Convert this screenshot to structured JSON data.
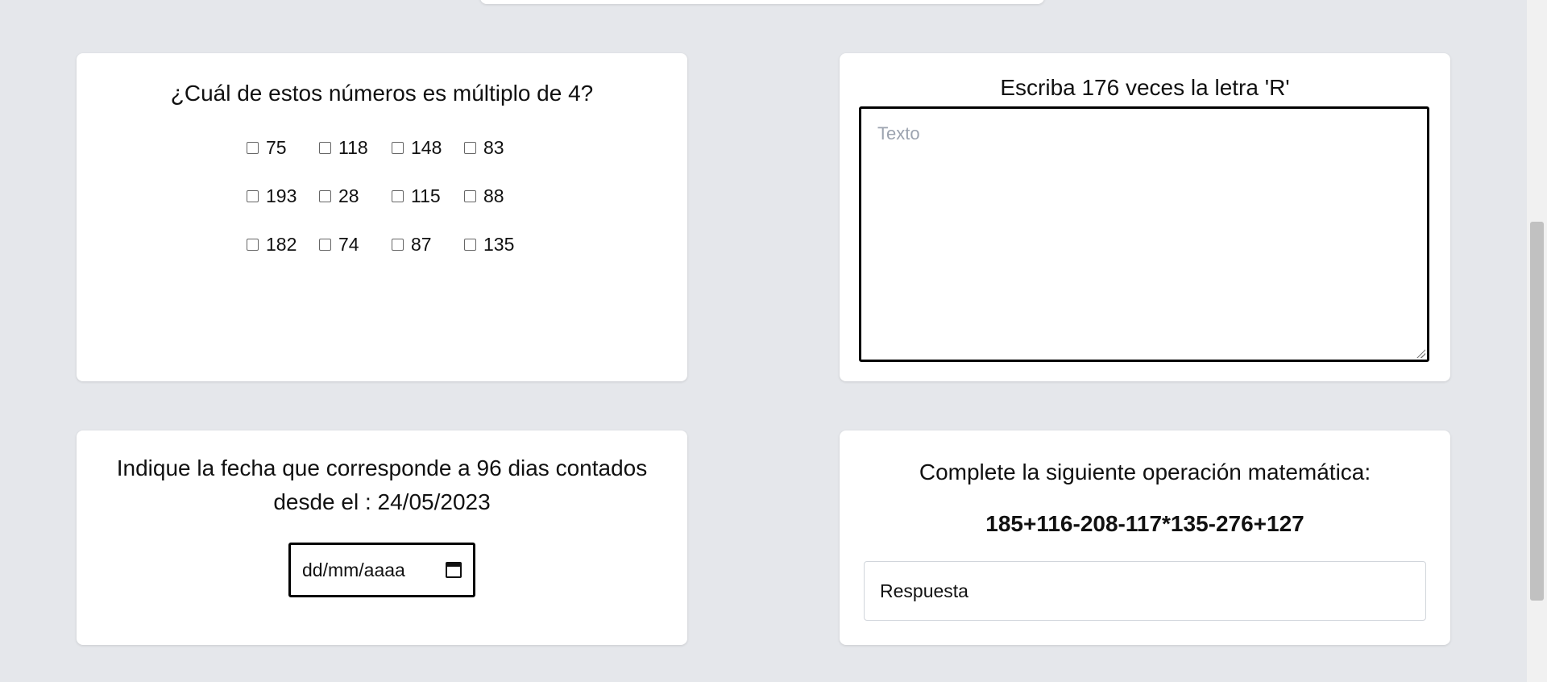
{
  "multiple_choice": {
    "question": "¿Cuál de estos números es múltiplo de 4?",
    "options": [
      "75",
      "118",
      "148",
      "83",
      "193",
      "28",
      "115",
      "88",
      "182",
      "74",
      "87",
      "135"
    ]
  },
  "text_task": {
    "instruction": "Escriba 176 veces la letra 'R'",
    "placeholder": "Texto"
  },
  "date_task": {
    "question": "Indique la fecha que corresponde a 96 dias contados desde el : 24/05/2023",
    "placeholder": "dd/mm/aaaa"
  },
  "math_task": {
    "instruction": "Complete la siguiente operación matemática:",
    "expression": "185+116-208-117*135-276+127",
    "placeholder": "Respuesta"
  }
}
